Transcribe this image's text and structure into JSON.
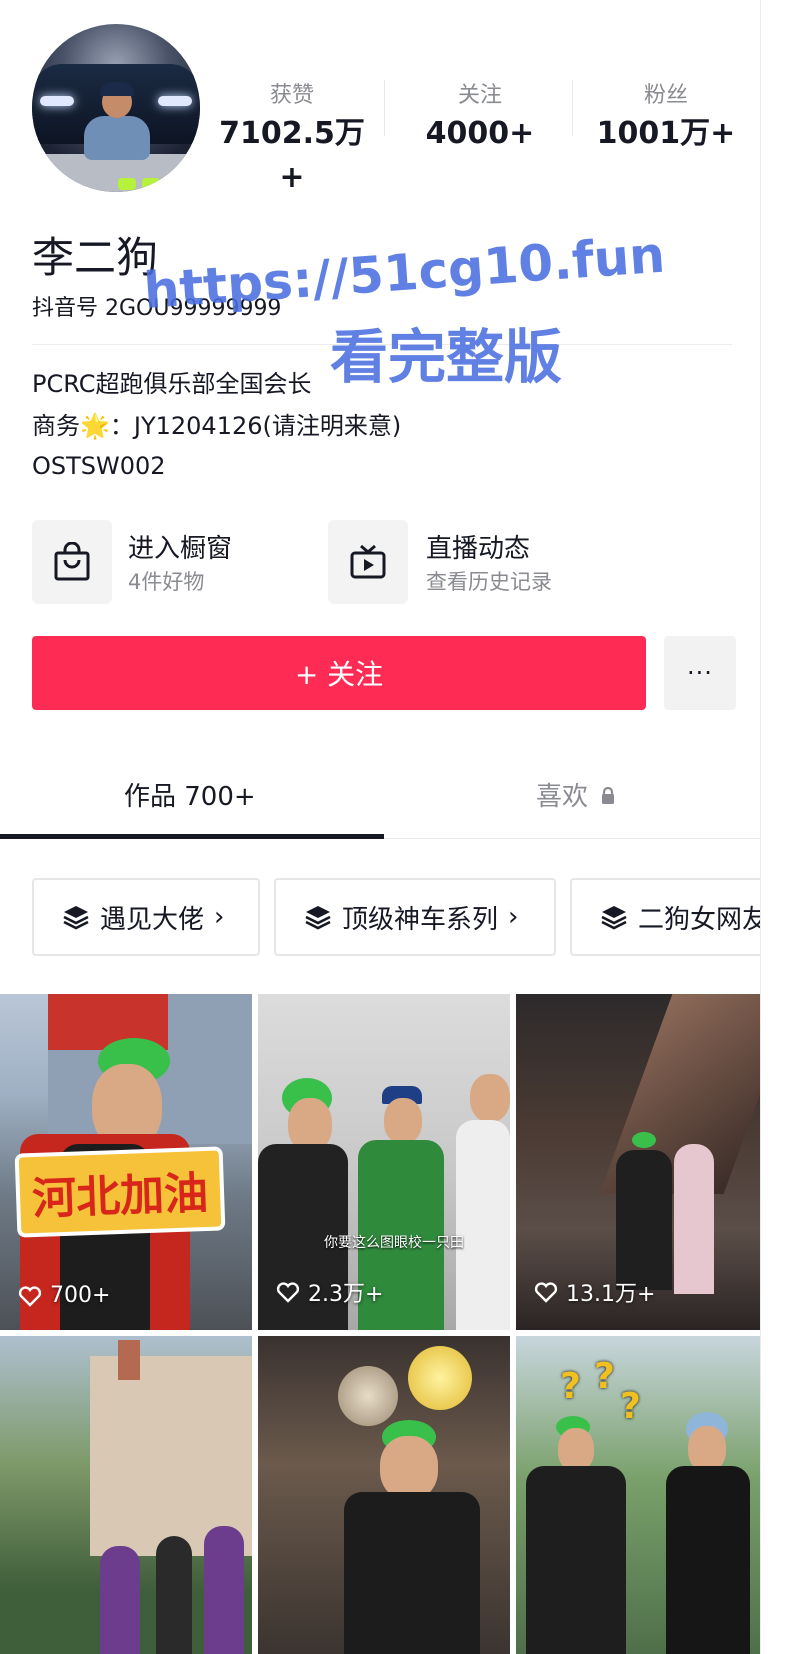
{
  "profile": {
    "name": "李二狗",
    "uid": "抖音号 2GOU99999999",
    "stats": [
      {
        "label": "获赞",
        "value": "7102.5万+"
      },
      {
        "label": "关注",
        "value": "4000+"
      },
      {
        "label": "粉丝",
        "value": "1001万+"
      }
    ],
    "bio": [
      "PCRC超跑俱乐部全国会长",
      "商务🌟：JY1204126(请注明来意)",
      "OSTSW002"
    ]
  },
  "watermark": {
    "line1": "https://51cg10.fun",
    "line2": "看完整版"
  },
  "cards": [
    {
      "title": "进入橱窗",
      "subtitle": "4件好物",
      "icon": "shopping-bag-icon"
    },
    {
      "title": "直播动态",
      "subtitle": "查看历史记录",
      "icon": "live-tv-icon"
    }
  ],
  "actions": {
    "follow_label": "+ 关注",
    "more_label": "···"
  },
  "tabs": [
    {
      "label": "作品 700+",
      "active": true
    },
    {
      "label": "喜欢",
      "active": false,
      "locked": true
    }
  ],
  "collections": [
    {
      "label": "遇见大佬"
    },
    {
      "label": "顶级神车系列"
    },
    {
      "label": "二狗女网友"
    }
  ],
  "videos": [
    {
      "likes": "700+",
      "overlay_text": "河北加油"
    },
    {
      "likes": "2.3万+",
      "overlay_text": "你要这么图眼校一只田"
    },
    {
      "likes": "13.1万+"
    },
    {},
    {},
    {}
  ],
  "colors": {
    "accent": "#fe2c55",
    "text": "#161823",
    "muted": "#8a8b91",
    "watermark": "#4a6ee0"
  }
}
